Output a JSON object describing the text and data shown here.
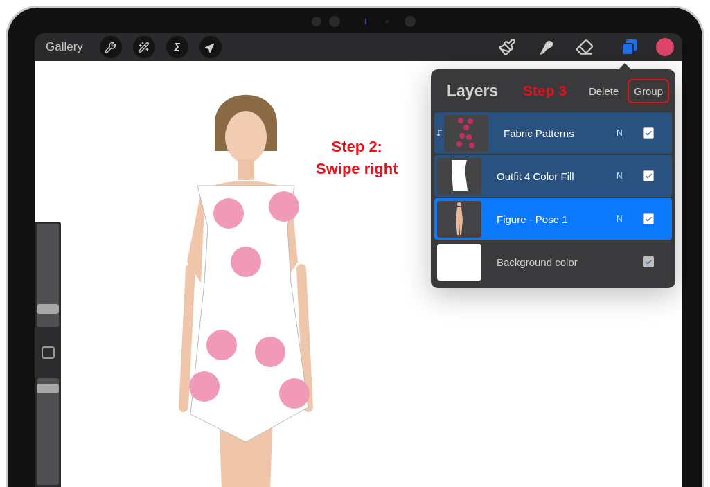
{
  "toolbar": {
    "gallery": "Gallery",
    "color_swatch": {
      "color": "#dc4468"
    }
  },
  "annotations": [
    {
      "text": "Step 2:\nSwipe right"
    }
  ],
  "side_sliders": [
    {
      "kind": "size",
      "level": 0.18
    },
    {
      "kind": "opacity",
      "level": 0.95
    }
  ],
  "layers_panel": {
    "title": "Layers",
    "annotation": "Step 3",
    "actions": [
      {
        "label": "Delete",
        "highlighted": false
      },
      {
        "label": "Group",
        "highlighted": true
      }
    ],
    "layers": [
      {
        "name": "Fabric Patterns",
        "kind": "pattern",
        "blend": "N",
        "visible": true,
        "selected": true,
        "active": false,
        "clipped": true
      },
      {
        "name": "Outfit 4 Color Fill",
        "kind": "outfit",
        "blend": "N",
        "visible": true,
        "selected": true,
        "active": false,
        "clipped": false
      },
      {
        "name": "Figure - Pose 1",
        "kind": "figure",
        "blend": "N",
        "visible": true,
        "selected": true,
        "active": true,
        "clipped": false
      },
      {
        "name": "Background color",
        "kind": "blank",
        "visible": true,
        "selected": false,
        "active": false,
        "clipped": false
      }
    ]
  }
}
